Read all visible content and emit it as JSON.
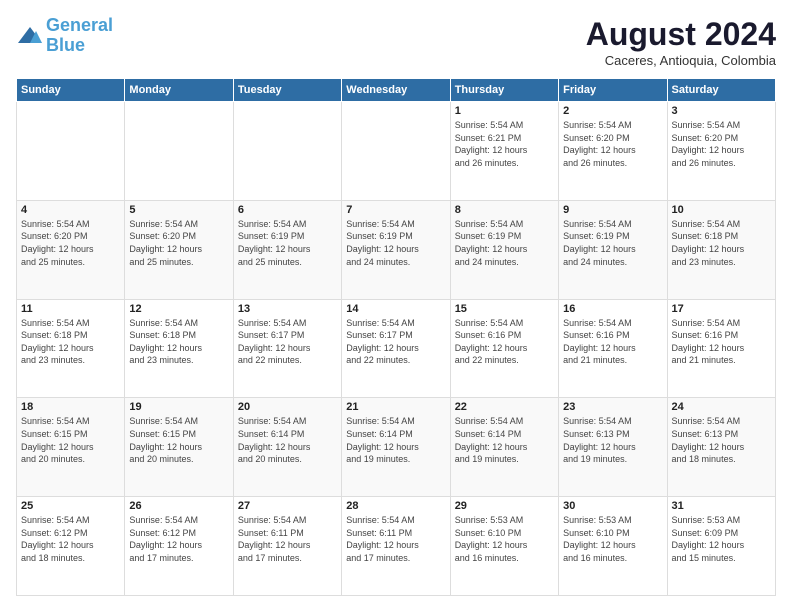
{
  "logo": {
    "line1": "General",
    "line2": "Blue"
  },
  "header": {
    "month_year": "August 2024",
    "location": "Caceres, Antioquia, Colombia"
  },
  "days_of_week": [
    "Sunday",
    "Monday",
    "Tuesday",
    "Wednesday",
    "Thursday",
    "Friday",
    "Saturday"
  ],
  "weeks": [
    [
      {
        "day": "",
        "info": ""
      },
      {
        "day": "",
        "info": ""
      },
      {
        "day": "",
        "info": ""
      },
      {
        "day": "",
        "info": ""
      },
      {
        "day": "1",
        "info": "Sunrise: 5:54 AM\nSunset: 6:21 PM\nDaylight: 12 hours\nand 26 minutes."
      },
      {
        "day": "2",
        "info": "Sunrise: 5:54 AM\nSunset: 6:20 PM\nDaylight: 12 hours\nand 26 minutes."
      },
      {
        "day": "3",
        "info": "Sunrise: 5:54 AM\nSunset: 6:20 PM\nDaylight: 12 hours\nand 26 minutes."
      }
    ],
    [
      {
        "day": "4",
        "info": "Sunrise: 5:54 AM\nSunset: 6:20 PM\nDaylight: 12 hours\nand 25 minutes."
      },
      {
        "day": "5",
        "info": "Sunrise: 5:54 AM\nSunset: 6:20 PM\nDaylight: 12 hours\nand 25 minutes."
      },
      {
        "day": "6",
        "info": "Sunrise: 5:54 AM\nSunset: 6:19 PM\nDaylight: 12 hours\nand 25 minutes."
      },
      {
        "day": "7",
        "info": "Sunrise: 5:54 AM\nSunset: 6:19 PM\nDaylight: 12 hours\nand 24 minutes."
      },
      {
        "day": "8",
        "info": "Sunrise: 5:54 AM\nSunset: 6:19 PM\nDaylight: 12 hours\nand 24 minutes."
      },
      {
        "day": "9",
        "info": "Sunrise: 5:54 AM\nSunset: 6:19 PM\nDaylight: 12 hours\nand 24 minutes."
      },
      {
        "day": "10",
        "info": "Sunrise: 5:54 AM\nSunset: 6:18 PM\nDaylight: 12 hours\nand 23 minutes."
      }
    ],
    [
      {
        "day": "11",
        "info": "Sunrise: 5:54 AM\nSunset: 6:18 PM\nDaylight: 12 hours\nand 23 minutes."
      },
      {
        "day": "12",
        "info": "Sunrise: 5:54 AM\nSunset: 6:18 PM\nDaylight: 12 hours\nand 23 minutes."
      },
      {
        "day": "13",
        "info": "Sunrise: 5:54 AM\nSunset: 6:17 PM\nDaylight: 12 hours\nand 22 minutes."
      },
      {
        "day": "14",
        "info": "Sunrise: 5:54 AM\nSunset: 6:17 PM\nDaylight: 12 hours\nand 22 minutes."
      },
      {
        "day": "15",
        "info": "Sunrise: 5:54 AM\nSunset: 6:16 PM\nDaylight: 12 hours\nand 22 minutes."
      },
      {
        "day": "16",
        "info": "Sunrise: 5:54 AM\nSunset: 6:16 PM\nDaylight: 12 hours\nand 21 minutes."
      },
      {
        "day": "17",
        "info": "Sunrise: 5:54 AM\nSunset: 6:16 PM\nDaylight: 12 hours\nand 21 minutes."
      }
    ],
    [
      {
        "day": "18",
        "info": "Sunrise: 5:54 AM\nSunset: 6:15 PM\nDaylight: 12 hours\nand 20 minutes."
      },
      {
        "day": "19",
        "info": "Sunrise: 5:54 AM\nSunset: 6:15 PM\nDaylight: 12 hours\nand 20 minutes."
      },
      {
        "day": "20",
        "info": "Sunrise: 5:54 AM\nSunset: 6:14 PM\nDaylight: 12 hours\nand 20 minutes."
      },
      {
        "day": "21",
        "info": "Sunrise: 5:54 AM\nSunset: 6:14 PM\nDaylight: 12 hours\nand 19 minutes."
      },
      {
        "day": "22",
        "info": "Sunrise: 5:54 AM\nSunset: 6:14 PM\nDaylight: 12 hours\nand 19 minutes."
      },
      {
        "day": "23",
        "info": "Sunrise: 5:54 AM\nSunset: 6:13 PM\nDaylight: 12 hours\nand 19 minutes."
      },
      {
        "day": "24",
        "info": "Sunrise: 5:54 AM\nSunset: 6:13 PM\nDaylight: 12 hours\nand 18 minutes."
      }
    ],
    [
      {
        "day": "25",
        "info": "Sunrise: 5:54 AM\nSunset: 6:12 PM\nDaylight: 12 hours\nand 18 minutes."
      },
      {
        "day": "26",
        "info": "Sunrise: 5:54 AM\nSunset: 6:12 PM\nDaylight: 12 hours\nand 17 minutes."
      },
      {
        "day": "27",
        "info": "Sunrise: 5:54 AM\nSunset: 6:11 PM\nDaylight: 12 hours\nand 17 minutes."
      },
      {
        "day": "28",
        "info": "Sunrise: 5:54 AM\nSunset: 6:11 PM\nDaylight: 12 hours\nand 17 minutes."
      },
      {
        "day": "29",
        "info": "Sunrise: 5:53 AM\nSunset: 6:10 PM\nDaylight: 12 hours\nand 16 minutes."
      },
      {
        "day": "30",
        "info": "Sunrise: 5:53 AM\nSunset: 6:10 PM\nDaylight: 12 hours\nand 16 minutes."
      },
      {
        "day": "31",
        "info": "Sunrise: 5:53 AM\nSunset: 6:09 PM\nDaylight: 12 hours\nand 15 minutes."
      }
    ]
  ]
}
